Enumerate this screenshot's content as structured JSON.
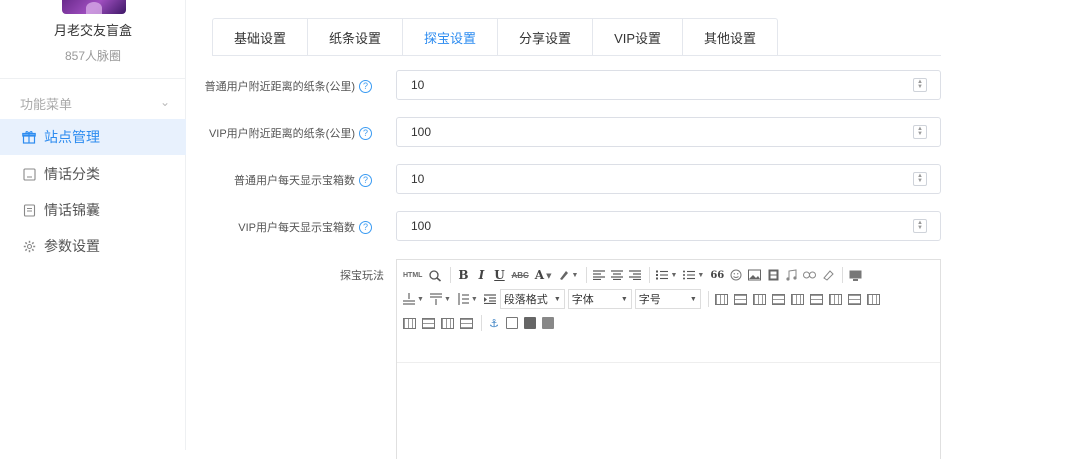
{
  "sidebar": {
    "site_name": "月老交友盲盒",
    "site_sub": "857人脉圈",
    "menu_title": "功能菜单",
    "menu_chevron": "chevron-down-icon",
    "items": [
      {
        "label": "站点管理",
        "icon": "gift-icon",
        "active": true
      },
      {
        "label": "情话分类",
        "icon": "square-icon",
        "active": false
      },
      {
        "label": "情话锦囊",
        "icon": "document-icon",
        "active": false
      },
      {
        "label": "参数设置",
        "icon": "gear-icon",
        "active": false
      }
    ]
  },
  "tabs": [
    {
      "label": "基础设置",
      "active": false
    },
    {
      "label": "纸条设置",
      "active": false
    },
    {
      "label": "探宝设置",
      "active": true
    },
    {
      "label": "分享设置",
      "active": false
    },
    {
      "label": "VIP设置",
      "active": false
    },
    {
      "label": "其他设置",
      "active": false
    }
  ],
  "form": {
    "fields": [
      {
        "label": "普通用户附近距离的纸条(公里)",
        "value": "10"
      },
      {
        "label": "VIP用户附近距离的纸条(公里)",
        "value": "100"
      },
      {
        "label": "普通用户每天显示宝箱数",
        "value": "10"
      },
      {
        "label": "VIP用户每天显示宝箱数",
        "value": "100"
      }
    ],
    "help_symbol": "?",
    "editor_label": "探宝玩法"
  },
  "editor_toolbar": {
    "html_label": "HTML",
    "bold": "B",
    "italic": "I",
    "underline": "U",
    "strike": "ABC",
    "font_color": "A",
    "paragraph": "段落格式",
    "font_family": "字体",
    "font_size": "字号",
    "quote": "66"
  },
  "colors": {
    "accent": "#2d8cf0",
    "active_menu_bg": "#e8f1fd",
    "border": "#dcdfe6"
  }
}
